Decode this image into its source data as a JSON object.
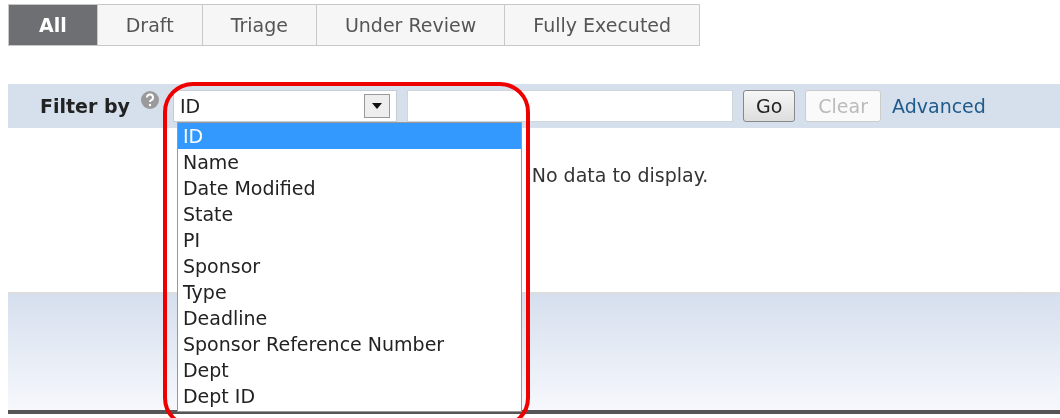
{
  "tabs": [
    {
      "label": "All",
      "selected": true
    },
    {
      "label": "Draft",
      "selected": false
    },
    {
      "label": "Triage",
      "selected": false
    },
    {
      "label": "Under Review",
      "selected": false
    },
    {
      "label": "Fully Executed",
      "selected": false
    }
  ],
  "filter": {
    "label": "Filter by",
    "select_value": "ID",
    "expanded": true,
    "options": [
      {
        "label": "ID",
        "selected": true
      },
      {
        "label": "Name",
        "selected": false
      },
      {
        "label": "Date Modified",
        "selected": false
      },
      {
        "label": "State",
        "selected": false
      },
      {
        "label": "PI",
        "selected": false
      },
      {
        "label": "Sponsor",
        "selected": false
      },
      {
        "label": "Type",
        "selected": false
      },
      {
        "label": "Deadline",
        "selected": false
      },
      {
        "label": "Sponsor Reference Number",
        "selected": false
      },
      {
        "label": "Dept",
        "selected": false
      },
      {
        "label": "Dept ID",
        "selected": false
      }
    ],
    "go_button": {
      "label": "Go",
      "disabled": false
    },
    "clear_button": {
      "label": "Clear",
      "disabled": true
    },
    "advanced_link": "Advanced"
  },
  "empty_message": "No data to display."
}
